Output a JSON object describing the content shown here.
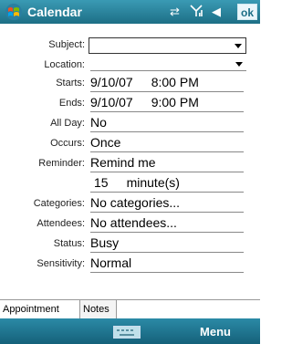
{
  "header": {
    "title": "Calendar",
    "ok_label": "ok",
    "status_icons": [
      "connectivity-icon",
      "signal-icon",
      "speaker-icon"
    ]
  },
  "form": {
    "subject": {
      "label": "Subject:",
      "value": ""
    },
    "location": {
      "label": "Location:",
      "value": ""
    },
    "starts": {
      "label": "Starts:",
      "date": "9/10/07",
      "time": "8:00 PM"
    },
    "ends": {
      "label": "Ends:",
      "date": "9/10/07",
      "time": "9:00 PM"
    },
    "all_day": {
      "label": "All Day:",
      "value": "No"
    },
    "occurs": {
      "label": "Occurs:",
      "value": "Once"
    },
    "reminder": {
      "label": "Reminder:",
      "value": "Remind me",
      "amount": "15",
      "unit": "minute(s)"
    },
    "categories": {
      "label": "Categories:",
      "value": "No categories..."
    },
    "attendees": {
      "label": "Attendees:",
      "value": "No attendees..."
    },
    "status": {
      "label": "Status:",
      "value": "Busy"
    },
    "sensitivity": {
      "label": "Sensitivity:",
      "value": "Normal"
    }
  },
  "tabs": [
    {
      "label": "Appointment",
      "active": true
    },
    {
      "label": "Notes",
      "active": false
    }
  ],
  "menubar": {
    "menu_label": "Menu"
  },
  "colors": {
    "titlebar": "#1d6f86",
    "menubar": "#15617a"
  }
}
